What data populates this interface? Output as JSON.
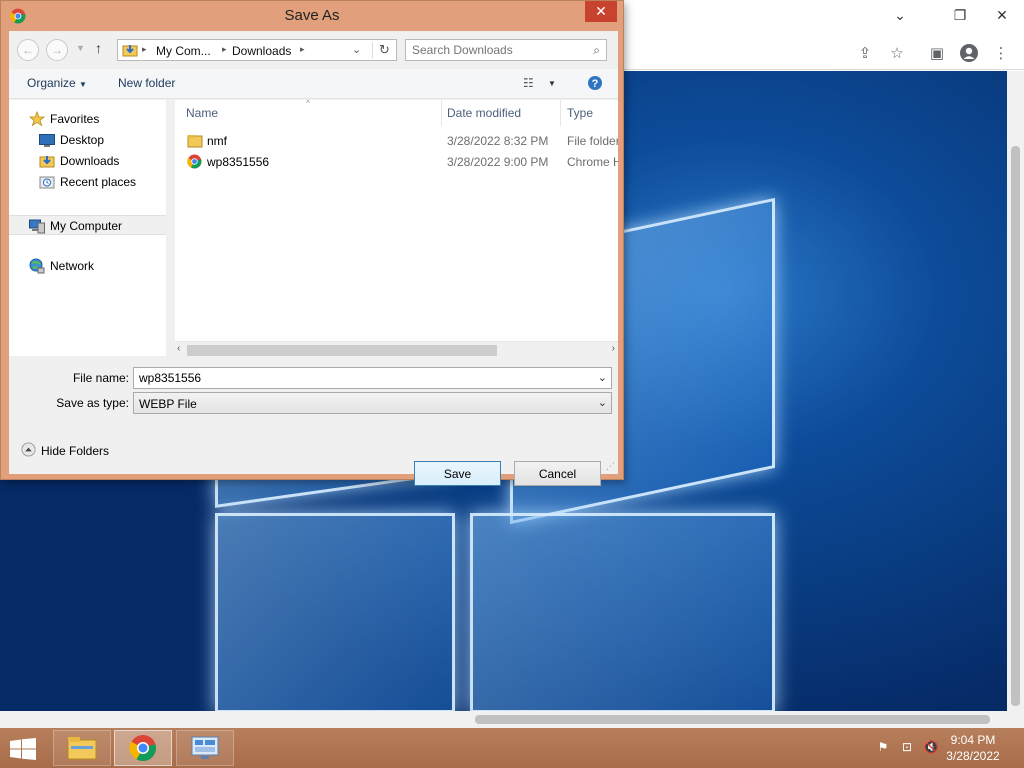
{
  "dialog": {
    "title": "Save As",
    "close_label": "✕",
    "breadcrumb": [
      "My Com...",
      "Downloads"
    ],
    "search_placeholder": "Search Downloads",
    "commands": {
      "organize": "Organize",
      "new_folder": "New folder"
    },
    "nav": {
      "favorites": "Favorites",
      "desktop": "Desktop",
      "downloads": "Downloads",
      "recent": "Recent places",
      "my_computer": "My Computer",
      "network": "Network"
    },
    "columns": {
      "name": "Name",
      "date": "Date modified",
      "type": "Type"
    },
    "files": [
      {
        "name": "nmf",
        "date": "3/28/2022 8:32 PM",
        "type": "File folder",
        "icon": "folder-icon"
      },
      {
        "name": "wp8351556",
        "date": "3/28/2022 9:00 PM",
        "type": "Chrome H",
        "icon": "chrome-file-icon"
      }
    ],
    "file_name_label": "File name:",
    "file_name_value": "wp8351556",
    "save_type_label": "Save as type:",
    "save_type_value": "WEBP File",
    "hide_folders": "Hide Folders",
    "save_button": "Save",
    "cancel_button": "Cancel"
  },
  "taskbar": {
    "time": "9:04 PM",
    "date": "3/28/2022"
  },
  "colors": {
    "dialog_frame": "#e1a07b",
    "close_button": "#c7432e",
    "taskbar": "#b0734f",
    "desktop_blue": "#0a3f86"
  }
}
